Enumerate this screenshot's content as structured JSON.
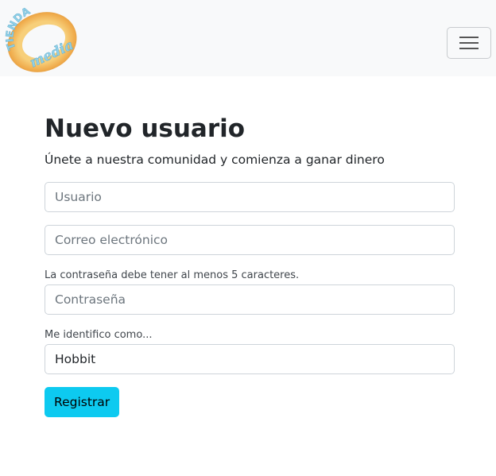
{
  "brand": {
    "logo_text_top": "TIENDA",
    "logo_text_bottom": "media",
    "colors": {
      "ring": "#f4b860",
      "text": "#8fd0e8"
    }
  },
  "navbar": {
    "toggler_icon": "hamburger-menu-icon"
  },
  "form": {
    "title": "Nuevo usuario",
    "subtitle": "Únete a nuestra comunidad y comienza a ganar dinero",
    "username_placeholder": "Usuario",
    "email_placeholder": "Correo electrónico",
    "password_help": "La contraseña debe tener al menos 5 caracteres.",
    "password_placeholder": "Contraseña",
    "identity_label": "Me identifico como...",
    "identity_value": "Hobbit",
    "submit_label": "Registrar"
  },
  "colors": {
    "navbar_bg": "#f8f9fa",
    "button_bg": "#0dcaf0",
    "input_border": "#ced4da"
  }
}
